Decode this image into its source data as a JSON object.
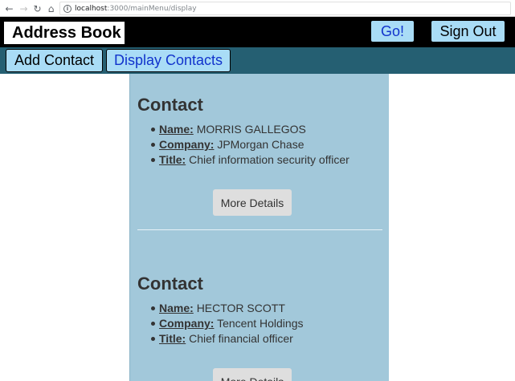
{
  "browser": {
    "url_host": "localhost",
    "url_path": ":3000/mainMenu/display"
  },
  "header": {
    "title": "Address Book",
    "go_label": "Go!",
    "signout_label": "Sign Out"
  },
  "nav": {
    "add_label": "Add Contact",
    "display_label": "Display Contacts"
  },
  "contacts": [
    {
      "heading": "Contact",
      "name_label": "Name:",
      "name": "MORRIS GALLEGOS",
      "company_label": "Company:",
      "company": "JPMorgan Chase",
      "title_label": "Title:",
      "title": "Chief information security officer",
      "button_label": "More Details"
    },
    {
      "heading": "Contact",
      "name_label": "Name:",
      "name": "HECTOR SCOTT",
      "company_label": "Company:",
      "company": "Tencent Holdings",
      "title_label": "Title:",
      "title": "Chief financial officer",
      "button_label": "More Details"
    }
  ]
}
